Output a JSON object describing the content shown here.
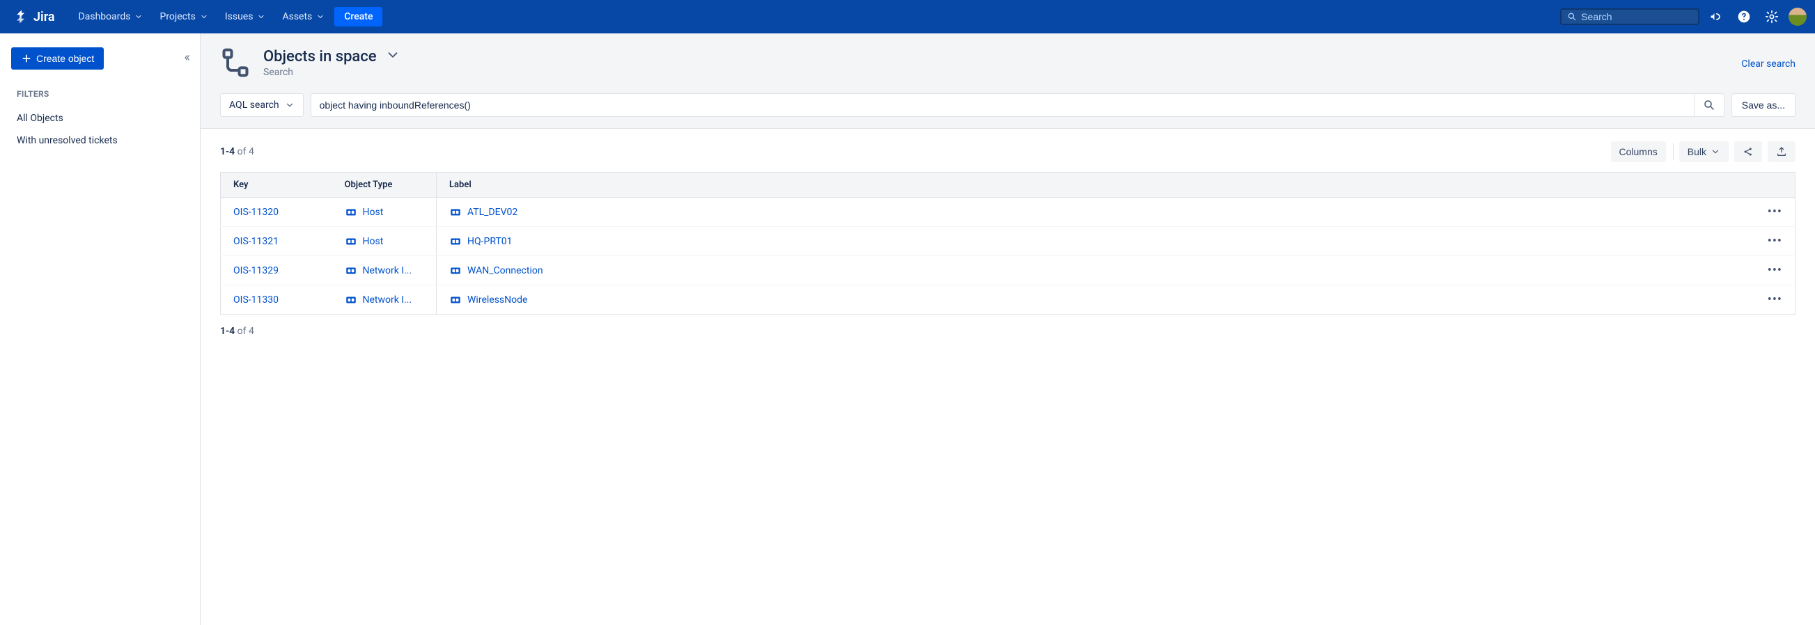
{
  "nav": {
    "product": "Jira",
    "items": [
      "Dashboards",
      "Projects",
      "Issues",
      "Assets"
    ],
    "create": "Create",
    "search_placeholder": "Search"
  },
  "sidebar": {
    "create_object": "Create object",
    "filters_heading": "FILTERS",
    "filters": [
      "All Objects",
      "With unresolved tickets"
    ]
  },
  "page": {
    "title": "Objects in space",
    "subtitle": "Search",
    "clear_search": "Clear search"
  },
  "search": {
    "mode_label": "AQL search",
    "query": "object having inboundReferences()",
    "save_as": "Save as..."
  },
  "toolbar": {
    "count_strong": "1-4",
    "count_suffix": " of 4",
    "columns": "Columns",
    "bulk": "Bulk"
  },
  "table": {
    "headers": {
      "key": "Key",
      "type": "Object Type",
      "label": "Label"
    },
    "rows": [
      {
        "key": "OIS-11320",
        "type": "Host",
        "label": "ATL_DEV02"
      },
      {
        "key": "OIS-11321",
        "type": "Host",
        "label": "HQ-PRT01"
      },
      {
        "key": "OIS-11329",
        "type": "Network I...",
        "label": "WAN_Connection"
      },
      {
        "key": "OIS-11330",
        "type": "Network I...",
        "label": "WirelessNode"
      }
    ]
  },
  "footer": {
    "count_strong": "1-4",
    "count_suffix": " of 4"
  }
}
